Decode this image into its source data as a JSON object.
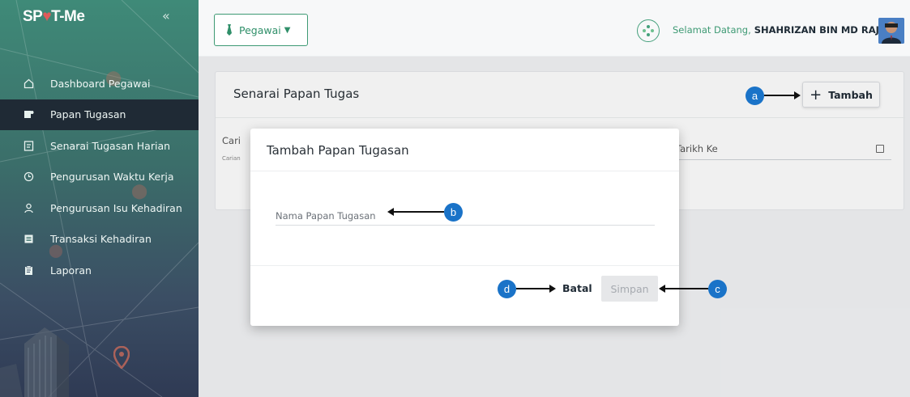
{
  "app": {
    "brand_prefix": "SP",
    "brand_suffix": "T-Me",
    "collapse_icon": "chevron-double-left-icon"
  },
  "sidebar": {
    "items": [
      {
        "label": "Dashboard Pegawai",
        "icon": "home-icon",
        "active": false
      },
      {
        "label": "Papan Tugasan",
        "icon": "board-icon",
        "active": true
      },
      {
        "label": "Senarai Tugasan Harian",
        "icon": "task-list-icon",
        "active": false
      },
      {
        "label": "Pengurusan Waktu Kerja",
        "icon": "clock-icon",
        "active": false
      },
      {
        "label": "Pengurusan Isu Kehadiran",
        "icon": "user-icon",
        "active": false
      },
      {
        "label": "Transaksi Kehadiran",
        "icon": "list-icon",
        "active": false
      },
      {
        "label": "Laporan",
        "icon": "report-icon",
        "active": false
      }
    ]
  },
  "header": {
    "role_label": "Pegawai",
    "welcome_prefix": "Selamat Datang,",
    "user_name": "SHAHRIZAN BIN MD RAJ..."
  },
  "card": {
    "title": "Senarai Papan Tugas",
    "add_label": "Tambah",
    "search_label": "Cari",
    "search_hint": "Carian",
    "date_to_label": "Tarikh Ke"
  },
  "modal": {
    "title": "Tambah Papan Tugasan",
    "field_label": "Nama Papan Tugasan",
    "cancel_label": "Batal",
    "save_label": "Simpan"
  },
  "callouts": {
    "a": "a",
    "b": "b",
    "c": "c",
    "d": "d"
  },
  "colors": {
    "accent": "#3e9a74",
    "callout": "#1a73c8",
    "active_nav": "#1f2a35"
  }
}
